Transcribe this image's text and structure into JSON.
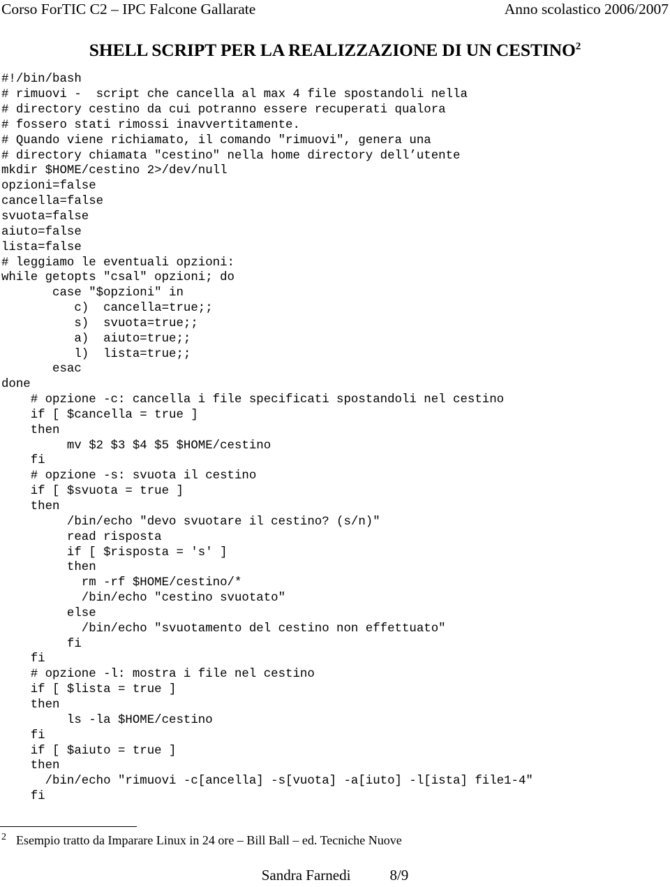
{
  "header": {
    "left": "Corso ForTIC C2 – IPC Falcone Gallarate",
    "right": "Anno scolastico 2006/2007"
  },
  "title": {
    "text": "SHELL SCRIPT PER LA REALIZZAZIONE DI UN CESTINO",
    "footnote_ref": "2"
  },
  "code": {
    "language": "bash",
    "lines": [
      "#!/bin/bash",
      "# rimuovi -  script che cancella al max 4 file spostandoli nella",
      "# directory cestino da cui potranno essere recuperati qualora",
      "# fossero stati rimossi inavvertitamente.",
      "# Quando viene richiamato, il comando \"rimuovi\", genera una",
      "# directory chiamata \"cestino\" nella home directory dell’utente",
      "mkdir $HOME/cestino 2>/dev/null",
      "opzioni=false",
      "cancella=false",
      "svuota=false",
      "aiuto=false",
      "lista=false",
      "# leggiamo le eventuali opzioni:",
      "while getopts \"csal\" opzioni; do",
      "       case \"$opzioni\" in",
      "          c)  cancella=true;;",
      "          s)  svuota=true;;",
      "          a)  aiuto=true;;",
      "          l)  lista=true;;",
      "       esac",
      "done",
      "    # opzione -c: cancella i file specificati spostandoli nel cestino",
      "    if [ $cancella = true ]",
      "    then",
      "         mv $2 $3 $4 $5 $HOME/cestino",
      "    fi",
      "    # opzione -s: svuota il cestino",
      "    if [ $svuota = true ]",
      "    then",
      "         /bin/echo \"devo svuotare il cestino? (s/n)\"",
      "         read risposta",
      "         if [ $risposta = 's' ]",
      "         then",
      "           rm -rf $HOME/cestino/*",
      "           /bin/echo \"cestino svuotato\"",
      "         else",
      "           /bin/echo \"svuotamento del cestino non effettuato\"",
      "         fi",
      "    fi",
      "    # opzione -l: mostra i file nel cestino",
      "    if [ $lista = true ]",
      "    then",
      "         ls -la $HOME/cestino",
      "    fi",
      "    if [ $aiuto = true ]",
      "    then",
      "      /bin/echo \"rimuovi -c[ancella] -s[vuota] -a[iuto] -l[ista] file1-4\"",
      "    fi"
    ]
  },
  "footnote": {
    "number": "2",
    "text": "Esempio tratto da Imparare Linux in 24 ore – Bill Ball – ed. Tecniche Nuove"
  },
  "footer": {
    "author": "Sandra Farnedi",
    "page": "8/9"
  }
}
